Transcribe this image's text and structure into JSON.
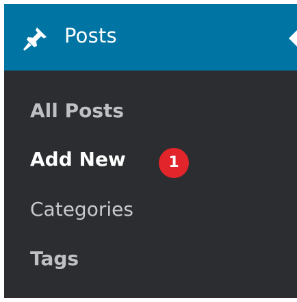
{
  "header": {
    "title": "Posts",
    "icon": "pushpin-icon",
    "background": "#0074a2"
  },
  "submenu": {
    "items": [
      {
        "label": "All Posts",
        "current": false
      },
      {
        "label": "Add New",
        "current": true
      },
      {
        "label": "Categories",
        "current": false
      },
      {
        "label": "Tags",
        "current": false
      }
    ],
    "background": "#2b2d30"
  },
  "callout": {
    "number": "1",
    "color": "#e2242b"
  }
}
